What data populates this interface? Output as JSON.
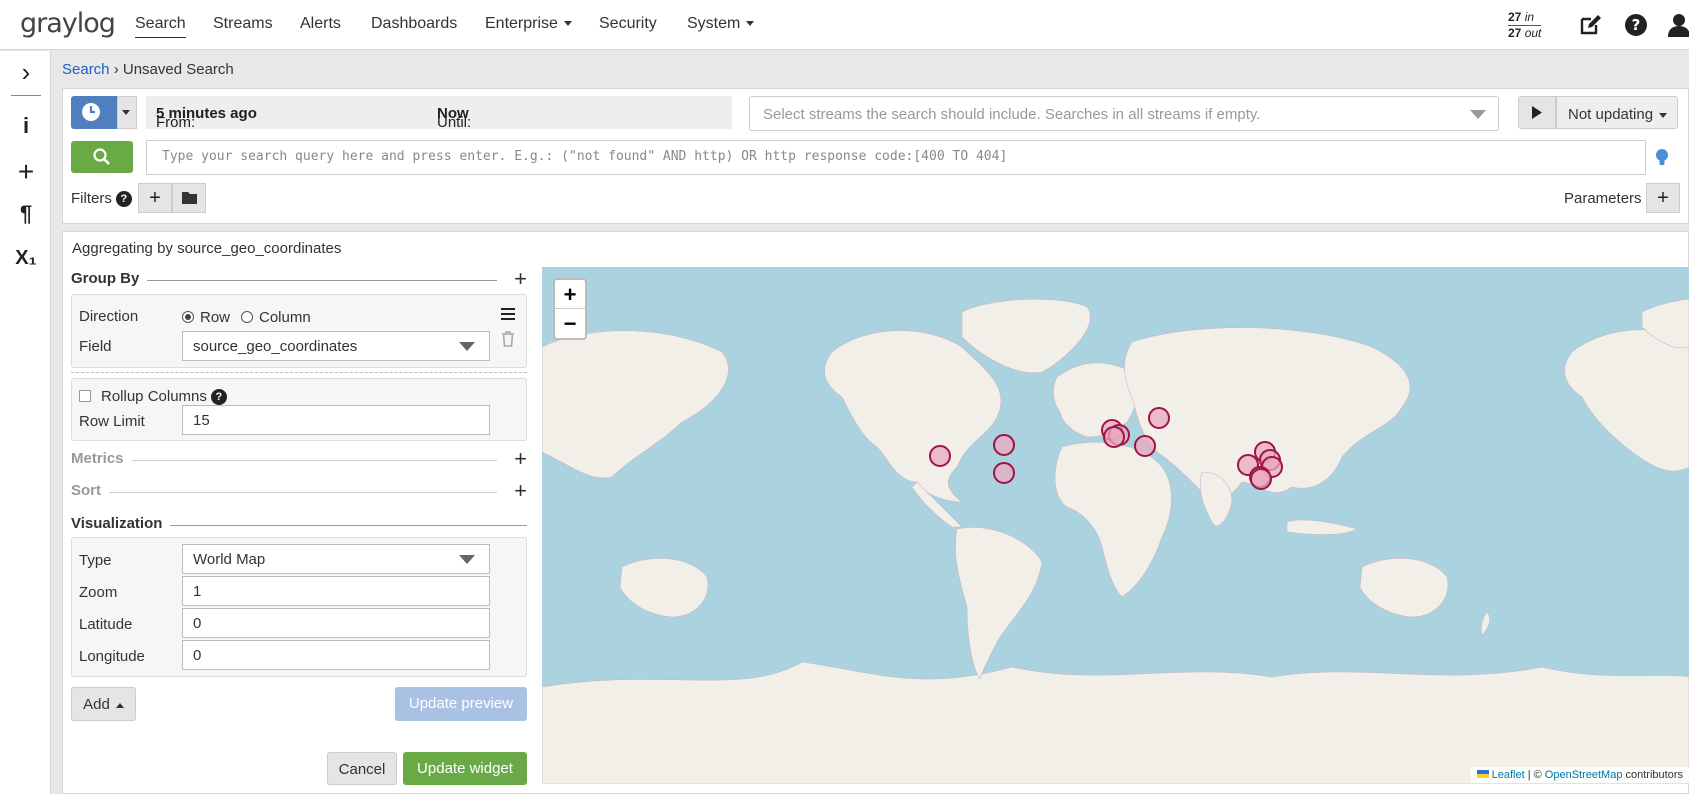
{
  "app": {
    "logo_text": "graylog"
  },
  "nav": {
    "items": [
      {
        "label": "Search",
        "active": true
      },
      {
        "label": "Streams"
      },
      {
        "label": "Alerts"
      },
      {
        "label": "Dashboards"
      },
      {
        "label": "Enterprise",
        "dropdown": true
      },
      {
        "label": "Security"
      },
      {
        "label": "System",
        "dropdown": true
      }
    ],
    "throughput": {
      "in_count": "27",
      "in_label": "in",
      "out_count": "27",
      "out_label": "out"
    },
    "icons": [
      "edit-icon",
      "help-icon",
      "user-icon"
    ]
  },
  "sidebar": {
    "icons": [
      "chevron-right-icon",
      "info-icon",
      "plus-icon",
      "paragraph-icon",
      "subscript-icon"
    ],
    "glyphs": [
      "›",
      "i",
      "+",
      "¶",
      "X₁"
    ]
  },
  "breadcrumb": {
    "root": "Search",
    "separator": "›",
    "current": "Unsaved Search"
  },
  "search": {
    "from_label": "From:",
    "from_value": "5 minutes ago",
    "until_label": "Until:",
    "until_value": "Now",
    "streams_placeholder": "Select streams the search should include. Searches in all streams if empty.",
    "refresh_label": "Not updating",
    "query_placeholder": "Type your search query here and press enter. E.g.: (\"not found\" AND http) OR http response code:[400 TO 404]",
    "filters_label": "Filters",
    "filters_help": "?",
    "parameters_label": "Parameters"
  },
  "widget": {
    "title": "Aggregating by source_geo_coordinates",
    "group_by": {
      "heading": "Group By",
      "direction_label": "Direction",
      "direction_options": [
        "Row",
        "Column"
      ],
      "direction_selected": "Row",
      "field_label": "Field",
      "field_value": "source_geo_coordinates",
      "rollup_label": "Rollup Columns",
      "rollup_help": "?",
      "row_limit_label": "Row Limit",
      "row_limit_value": "15"
    },
    "metrics_heading": "Metrics",
    "sort_heading": "Sort",
    "visualization": {
      "heading": "Visualization",
      "type_label": "Type",
      "type_value": "World Map",
      "zoom_label": "Zoom",
      "zoom_value": "1",
      "latitude_label": "Latitude",
      "latitude_value": "0",
      "longitude_label": "Longitude",
      "longitude_value": "0"
    },
    "add_label": "Add",
    "update_preview_label": "Update preview",
    "cancel_label": "Cancel",
    "update_widget_label": "Update widget"
  },
  "map": {
    "zoom_in": "+",
    "zoom_out": "−",
    "attribution_leaflet": "Leaflet",
    "attribution_sep": "| ©",
    "attribution_osm": "OpenStreetMap",
    "attribution_suffix": "contributors",
    "colors": {
      "water": "#aad3df",
      "land": "#f2efe9",
      "marker_fill": "#e9a9bf",
      "marker_stroke": "#a01346"
    }
  }
}
